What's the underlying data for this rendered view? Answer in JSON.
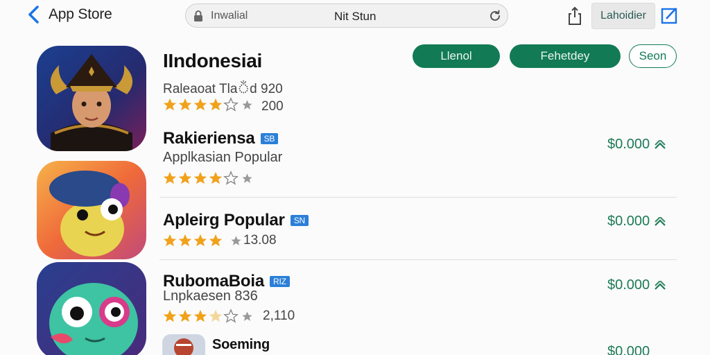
{
  "topbar": {
    "back_label": "App Store",
    "url_placeholder": "Inwalial",
    "url_value": "Nit Stun",
    "lang_button": "Lahoidier"
  },
  "hero": {
    "title": "IIndonesiai",
    "subtitle": "Raleaoat Tlaঁd 920",
    "rating_count": "200",
    "buttons": [
      "Llenol",
      "Fehetdey",
      "Seon"
    ]
  },
  "rows": [
    {
      "title": "Rakieriensa",
      "badge": "SB",
      "subtitle": "Applkasian Popular",
      "rating_count": "",
      "price": "$0.000"
    },
    {
      "title": "Apleirg Popular",
      "badge": "SN",
      "subtitle": "",
      "rating_count": "13.08",
      "price": "$0.000"
    },
    {
      "title": "RubomaBoia",
      "badge": "RIZ",
      "subtitle": "Lnpkaesen 836",
      "rating_count": "2,110",
      "price": "$0.000"
    },
    {
      "title": "Soeming",
      "badge": "",
      "subtitle": "",
      "rating_count": "",
      "price": "$0.000"
    }
  ],
  "colors": {
    "accent_green": "#127a55",
    "star": "#f0a21a",
    "badge_blue": "#2b7fd8",
    "back_blue": "#1a73e8"
  },
  "icons": [
    "chevron-left-icon",
    "lock-icon",
    "reload-icon",
    "share-icon",
    "edit-icon",
    "star-icon",
    "chevron-up-icon"
  ]
}
